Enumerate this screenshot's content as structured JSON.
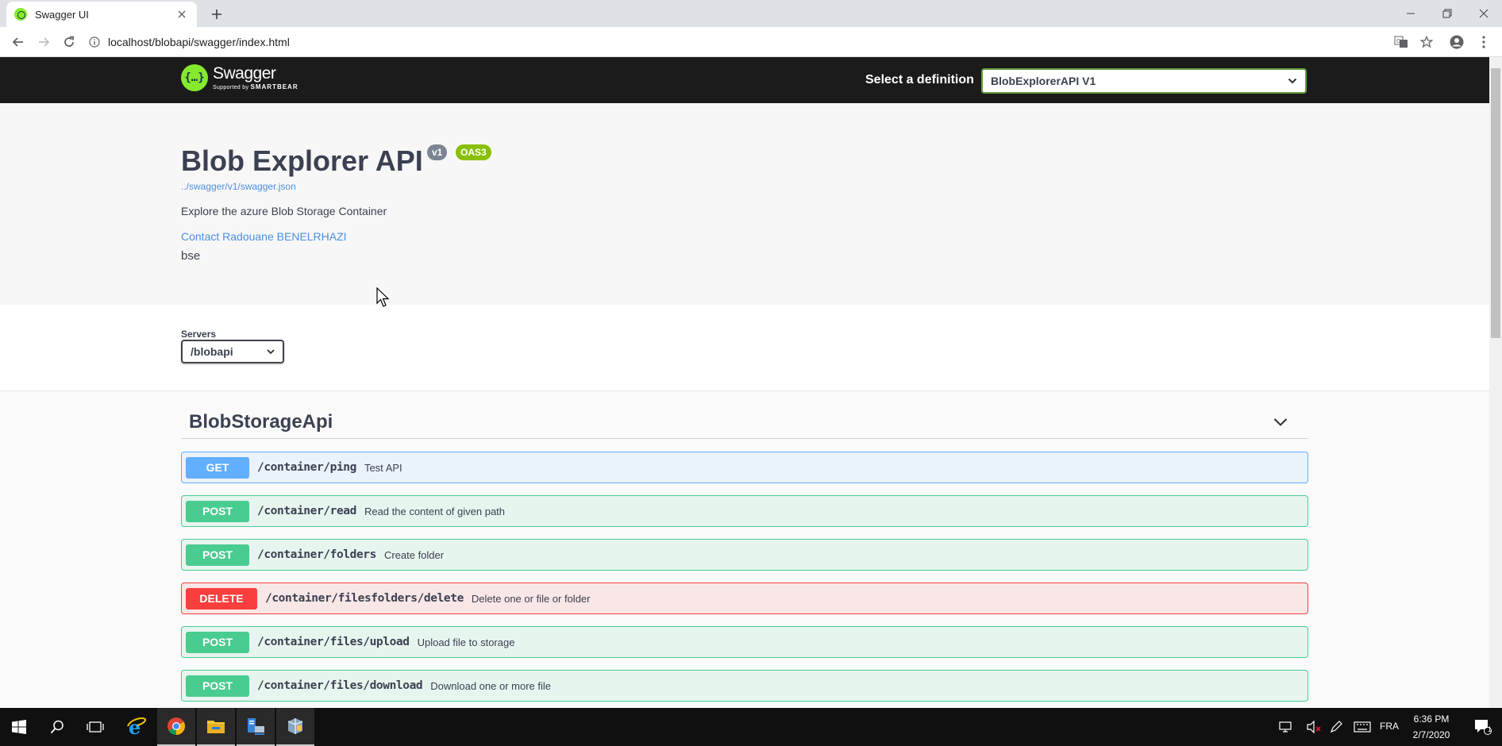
{
  "browser": {
    "tab_title": "Swagger UI",
    "url": "localhost/blobapi/swagger/index.html"
  },
  "topbar": {
    "logo_name": "Swagger",
    "logo_sub_prefix": "Supported by",
    "logo_sub_brand": "SMARTBEAR",
    "definition_label": "Select a definition",
    "definition_value": "BlobExplorerAPI V1"
  },
  "info": {
    "title": "Blob Explorer API",
    "version_badge": "v1",
    "oas_badge": "OAS3",
    "json_link": "../swagger/v1/swagger.json",
    "description": "Explore the azure Blob Storage Container",
    "contact": "Contact Radouane BENELRHAZI",
    "extra": "bse"
  },
  "servers": {
    "label": "Servers",
    "value": "/blobapi"
  },
  "tag": {
    "name": "BlobStorageApi"
  },
  "operations": [
    {
      "method": "GET",
      "path": "/container/ping",
      "summary": "Test API"
    },
    {
      "method": "POST",
      "path": "/container/read",
      "summary": "Read the content of given path"
    },
    {
      "method": "POST",
      "path": "/container/folders",
      "summary": "Create folder"
    },
    {
      "method": "DELETE",
      "path": "/container/filesfolders/delete",
      "summary": "Delete one or file or folder"
    },
    {
      "method": "POST",
      "path": "/container/files/upload",
      "summary": "Upload file to storage"
    },
    {
      "method": "POST",
      "path": "/container/files/download",
      "summary": "Download one or more file"
    }
  ],
  "taskbar": {
    "language": "FRA",
    "time": "6:36 PM",
    "date": "2/7/2020",
    "notification_count": "1"
  },
  "colors": {
    "get": "#61affe",
    "post": "#49cc90",
    "delete": "#f93e3e",
    "swagger_green": "#85ea2d",
    "link": "#4990e2"
  },
  "icons": [
    "swagger-favicon-icon",
    "close-icon",
    "plus-icon",
    "minimize-icon",
    "restore-icon",
    "back-icon",
    "forward-icon",
    "reload-icon",
    "info-icon",
    "translate-icon",
    "star-icon",
    "account-icon",
    "menu-icon",
    "chevron-down-icon",
    "windows-start-icon",
    "search-icon",
    "task-view-icon",
    "ie-icon",
    "chrome-icon",
    "file-explorer-icon",
    "server-manager-icon",
    "app-icon",
    "network-icon",
    "volume-icon",
    "pen-icon",
    "keyboard-icon",
    "notification-icon",
    "cursor-icon"
  ]
}
